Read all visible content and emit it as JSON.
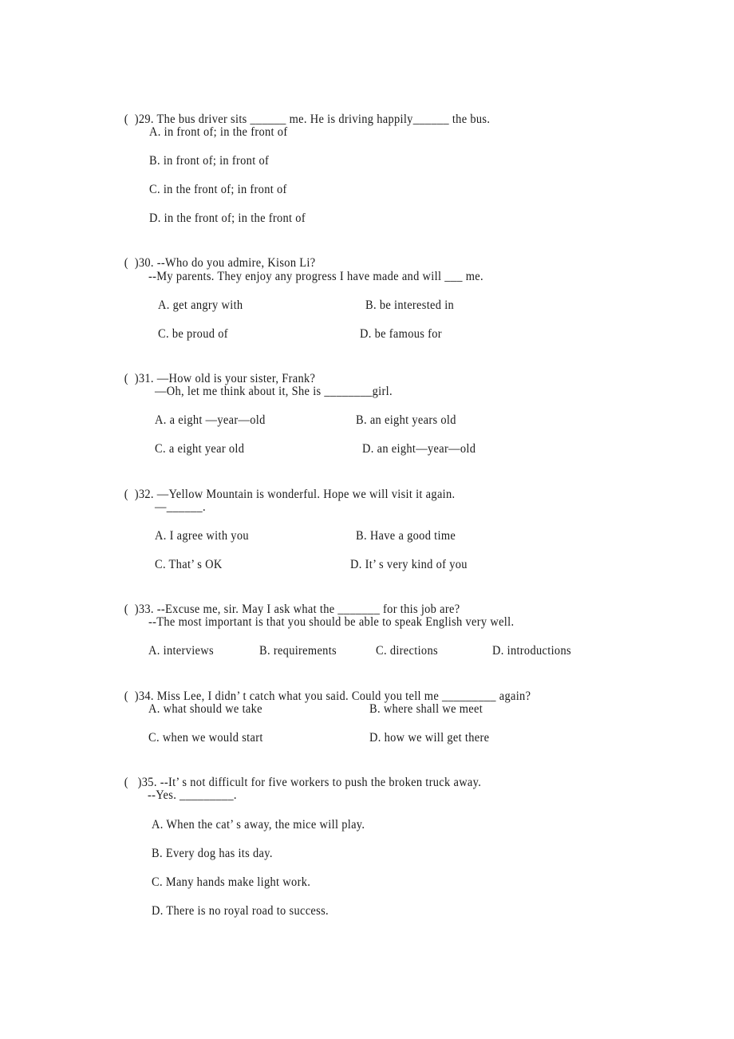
{
  "questions": [
    {
      "number": "29",
      "prefix": "(  )29.",
      "stem": "The bus driver sits ______ me. He is driving happily______ the bus.",
      "options": [
        {
          "label": "A.",
          "text": "in front of; in the front of"
        },
        {
          "label": "B.",
          "text": "in front of; in front of"
        },
        {
          "label": "C.",
          "text": "in the front of; in front of"
        },
        {
          "label": "D.",
          "text": "in the front of; in the front of"
        }
      ]
    },
    {
      "number": "30",
      "prefix": "(  )30.",
      "stem": "--Who do you admire, Kison Li?",
      "reply": "--My parents. They enjoy any progress I have made and will ___ me.",
      "options": [
        {
          "label": "A.",
          "text": "get angry with"
        },
        {
          "label": "B.",
          "text": "be interested in"
        },
        {
          "label": "C.",
          "text": "be proud of"
        },
        {
          "label": "D.",
          "text": "be famous for"
        }
      ]
    },
    {
      "number": "31",
      "prefix": "(  )31.",
      "stem": "—How old is your sister, Frank?",
      "reply": "—Oh, let me think about it, She is ________girl.",
      "options": [
        {
          "label": "A.",
          "text": "a eight —year—old"
        },
        {
          "label": "B.",
          "text": "an eight years old"
        },
        {
          "label": "C.",
          "text": "a eight year old"
        },
        {
          "label": "D.",
          "text": "an eight—year—old"
        }
      ]
    },
    {
      "number": "32",
      "prefix": "(  )32.",
      "stem": "—Yellow Mountain is wonderful. Hope we will visit it again.",
      "reply": "—______.",
      "options": [
        {
          "label": "A.",
          "text": "I agree with you"
        },
        {
          "label": "B.",
          "text": "Have a good time"
        },
        {
          "label": "C.",
          "text": "That’ s OK"
        },
        {
          "label": "D.",
          "text": "It’ s very kind of you"
        }
      ]
    },
    {
      "number": "33",
      "prefix": "(  )33.",
      "stem": "--Excuse me, sir. May I ask what the _______ for this job are?",
      "reply": "--The most important is that you should be able to speak English very well.",
      "options": [
        {
          "label": "A.",
          "text": "interviews"
        },
        {
          "label": "B.",
          "text": "requirements"
        },
        {
          "label": "C.",
          "text": "directions"
        },
        {
          "label": "D.",
          "text": "introductions"
        }
      ]
    },
    {
      "number": "34",
      "prefix": "(  )34.",
      "stem": "Miss Lee, I didn’ t catch what you said. Could you tell me _________ again?",
      "options": [
        {
          "label": "A.",
          "text": "what should we take"
        },
        {
          "label": "B.",
          "text": "where shall we meet"
        },
        {
          "label": "C.",
          "text": "when we would start"
        },
        {
          "label": "D.",
          "text": "how we will get there"
        }
      ]
    },
    {
      "number": "35",
      "prefix": "(   )35.",
      "stem": "--It’ s not difficult for five workers to push the broken truck away.",
      "reply": "--Yes. _________.",
      "options": [
        {
          "label": "A.",
          "text": "When the cat’ s away, the mice will play."
        },
        {
          "label": "B.",
          "text": "Every dog has its day."
        },
        {
          "label": "C.",
          "text": "Many hands make light work."
        },
        {
          "label": "D.",
          "text": "There is no royal road to success."
        }
      ]
    }
  ]
}
